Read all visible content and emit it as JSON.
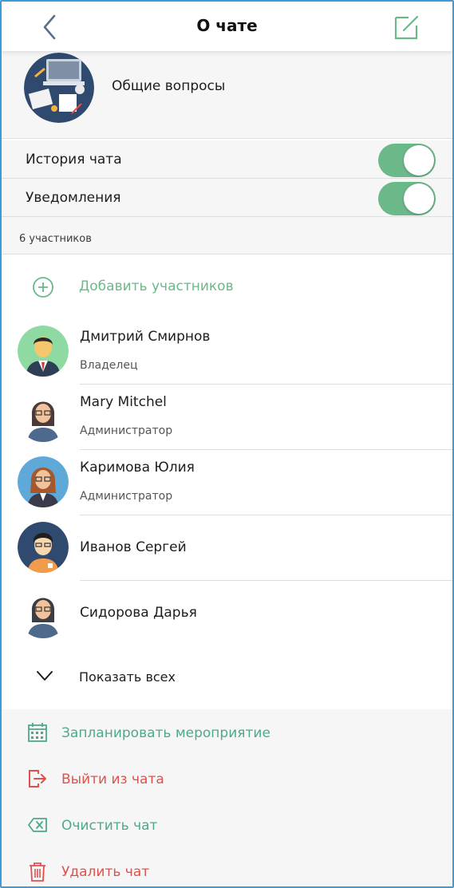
{
  "header": {
    "title": "О чате"
  },
  "chat": {
    "name": "Общие вопросы"
  },
  "settings": [
    {
      "label": "История чата",
      "enabled": true
    },
    {
      "label": "Уведомления",
      "enabled": true
    }
  ],
  "participants": {
    "count_label": "6 участников",
    "add_label": "Добавить участников",
    "show_all_label": "Показать всех",
    "members": [
      {
        "name": "Дмитрий Смирнов",
        "role": "Владелец"
      },
      {
        "name": "Mary Mitchel",
        "role": "Администратор"
      },
      {
        "name": "Каримова Юлия",
        "role": "Администратор"
      },
      {
        "name": "Иванов Сергей",
        "role": ""
      },
      {
        "name": "Сидорова Дарья",
        "role": ""
      }
    ]
  },
  "actions": {
    "schedule": "Запланировать мероприятие",
    "leave": "Выйти из чата",
    "clear": "Очистить чат",
    "delete": "Удалить чат"
  },
  "colors": {
    "accent_green": "#6bb889",
    "action_green": "#4da98b",
    "danger_red": "#e0514c",
    "icon_gray_blue": "#5b6f8c"
  }
}
